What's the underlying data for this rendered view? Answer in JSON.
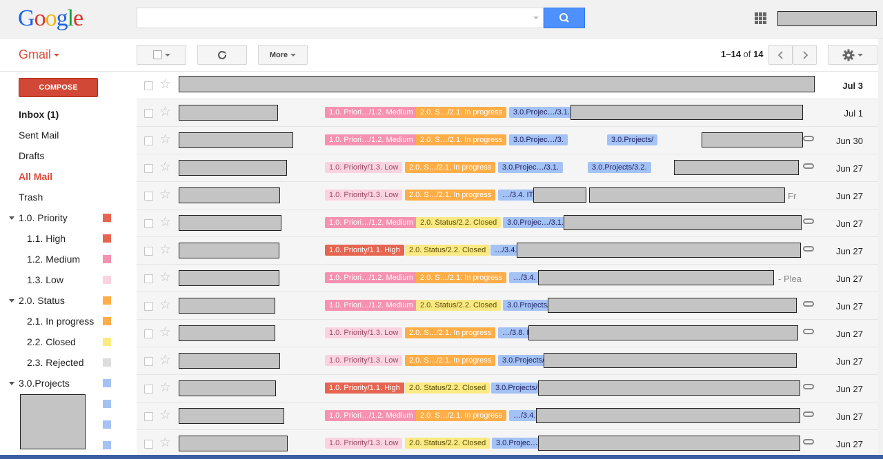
{
  "header": {
    "logo": [
      "G",
      "o",
      "o",
      "g",
      "l",
      "e"
    ],
    "logo_colors": [
      "#1a62e6",
      "#dd3428",
      "#f0b20a",
      "#1a62e6",
      "#169c3a",
      "#dd3428"
    ],
    "search_placeholder": ""
  },
  "toolbar": {
    "app_name": "Gmail",
    "more_label": "More",
    "pager_range": "1–14",
    "pager_of": "of",
    "pager_total": "14"
  },
  "sidebar": {
    "compose_label": "COMPOSE",
    "items": [
      {
        "label": "Inbox (1)"
      },
      {
        "label": "Sent Mail"
      },
      {
        "label": "Drafts"
      },
      {
        "label": "All Mail"
      },
      {
        "label": "Trash"
      },
      {
        "label": "1.0. Priority",
        "color": "#e66550"
      },
      {
        "label": "1.1. High",
        "color": "#e66550"
      },
      {
        "label": "1.2. Medium",
        "color": "#f691b2"
      },
      {
        "label": "1.3. Low",
        "color": "#fbd3e0"
      },
      {
        "label": "2.0. Status",
        "color": "#ffad47"
      },
      {
        "label": "2.1. In progress",
        "color": "#ffad47"
      },
      {
        "label": "2.2. Closed",
        "color": "#fbe983"
      },
      {
        "label": "2.3. Rejected",
        "color": "#dddddd"
      },
      {
        "label": "3.0.Projects",
        "color": "#a4c2f4"
      }
    ],
    "extra_swatch_color": "#a4c2f4"
  },
  "emails": [
    {
      "date": "Jul 3",
      "labels": []
    },
    {
      "date": "Jul 1",
      "labels": [
        "1.0. Priori…/1.2. Medium",
        "2.0. S…/2.1. In progress",
        "3.0.Projec…/3.1."
      ]
    },
    {
      "date": "Jun 30",
      "labels": [
        "1.0. Priori…/1.2. Medium",
        "2.0. S…/2.1. In progress",
        "3.0.Projec…/3.",
        "3.0.Projects/"
      ]
    },
    {
      "date": "Jun 27",
      "labels": [
        "1.0. Priority/1.3. Low",
        "2.0. S…/2.1. In progress",
        "3.0.Projec…/3.1.",
        "3.0.Projects/3.2."
      ]
    },
    {
      "date": "Jun 27",
      "labels": [
        "1.0. Priority/1.3. Low",
        "2.0. S…/2.1. In progress",
        "…/3.4. IT"
      ],
      "snippet": "Fr"
    },
    {
      "date": "Jun 27",
      "labels": [
        "1.0. Priori…/1.2. Medium",
        "2.0. Status/2.2. Closed",
        "3.0.Projec…/3.1."
      ]
    },
    {
      "date": "Jun 27",
      "labels": [
        "1.0. Priority/1.1. High",
        "2.0. Status/2.2. Closed",
        "…/3.4."
      ]
    },
    {
      "date": "Jun 27",
      "labels": [
        "1.0. Priori…/1.2. Medium",
        "2.0. S…/2.1. In progress",
        "…/3.4."
      ],
      "snippet": "- Plea"
    },
    {
      "date": "Jun 27",
      "labels": [
        "1.0. Priori…/1.2. Medium",
        "2.0. Status/2.2. Closed",
        "3.0.Projects/"
      ]
    },
    {
      "date": "Jun 27",
      "labels": [
        "1.0. Priority/1.3. Low",
        "2.0. S…/2.1. In progress",
        "…/3.8. F"
      ]
    },
    {
      "date": "Jun 27",
      "labels": [
        "1.0. Priority/1.3. Low",
        "2.0. S…/2.1. In progress",
        "3.0.Projects/"
      ]
    },
    {
      "date": "Jun 27",
      "labels": [
        "1.0. Priority/1.1. High",
        "2.0. Status/2.2. Closed",
        "3.0.Projects/"
      ]
    },
    {
      "date": "Jun 27",
      "labels": [
        "1.0. Priori…/1.2. Medium",
        "2.0. S…/2.1. In progress",
        "…/3.4."
      ]
    },
    {
      "date": "Jun 27",
      "labels": [
        "1.0. Priority/1.3. Low",
        "2.0. Status/2.2. Closed",
        "3.0.Projec…/3.1."
      ]
    }
  ]
}
